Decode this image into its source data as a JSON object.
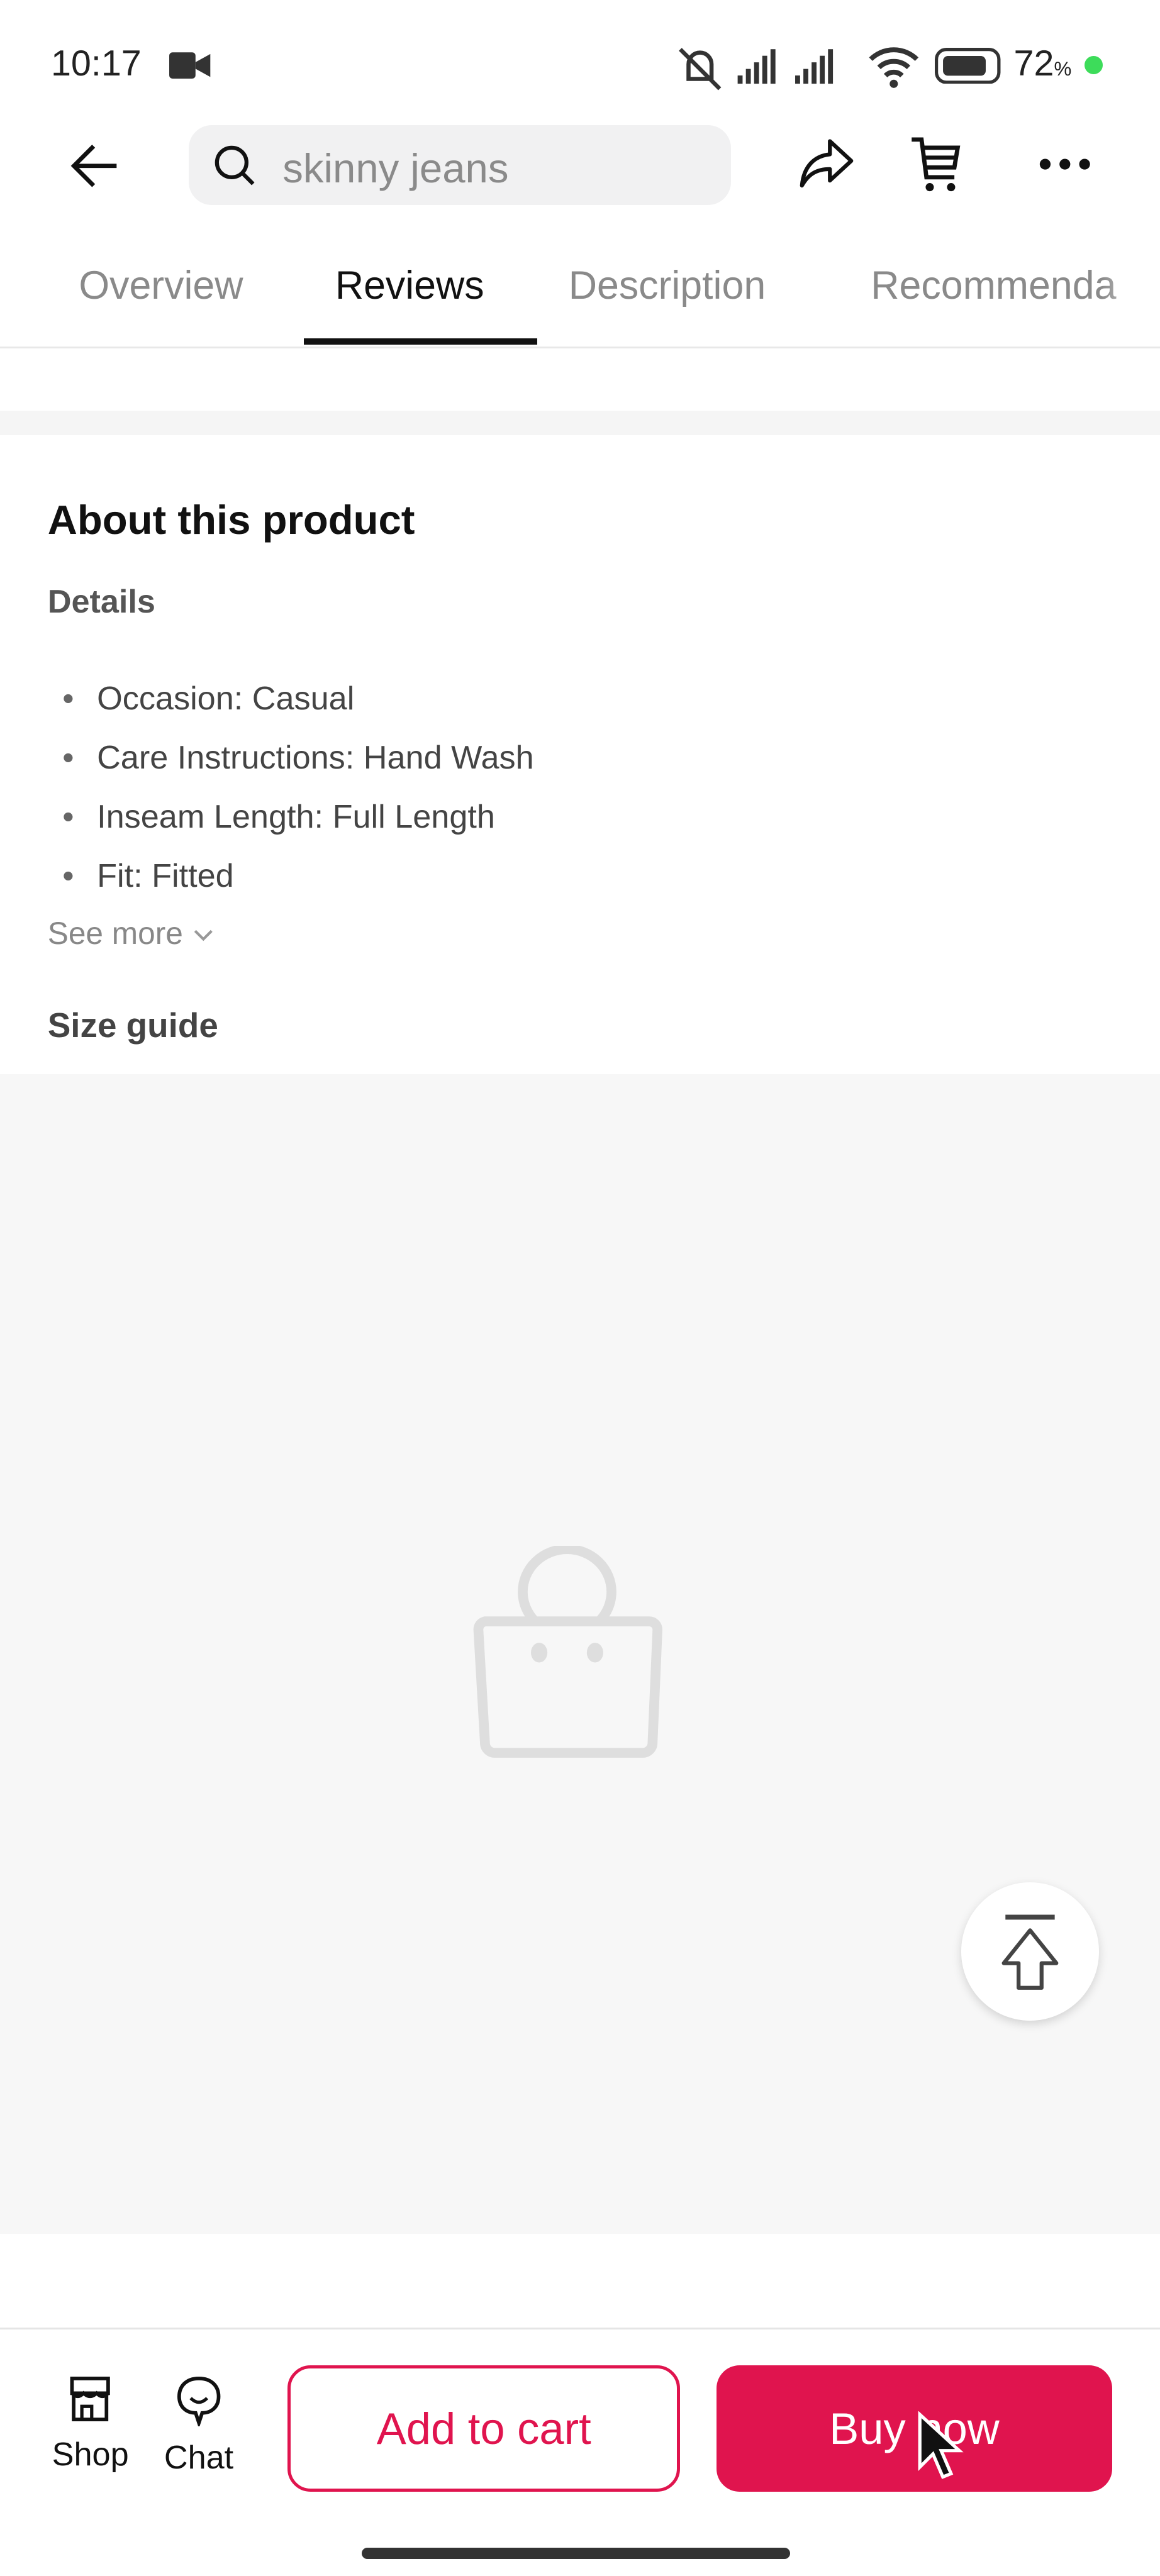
{
  "status_bar": {
    "time": "10:17",
    "battery": "72",
    "battery_unit": "%"
  },
  "header": {
    "search_placeholder": "skinny jeans",
    "icons": [
      "back-arrow-icon",
      "search-icon",
      "share-icon",
      "cart-icon",
      "more-icon"
    ]
  },
  "tabs": [
    {
      "label": "Overview",
      "active": false
    },
    {
      "label": "Reviews",
      "active": true
    },
    {
      "label": "Description",
      "active": false
    },
    {
      "label": "Recommenda",
      "active": false
    }
  ],
  "about": {
    "title": "About this product",
    "details_heading": "Details",
    "details": [
      "Occasion: Casual",
      "Care Instructions: Hand Wash",
      "Inseam Length: Full Length",
      "Fit: Fitted"
    ],
    "see_more": "See more",
    "size_guide": "Size guide"
  },
  "bottom_bar": {
    "shop_label": "Shop",
    "chat_label": "Chat",
    "add_to_cart": "Add to cart",
    "buy_now": "Buy now",
    "accent_color": "#e0144e"
  }
}
